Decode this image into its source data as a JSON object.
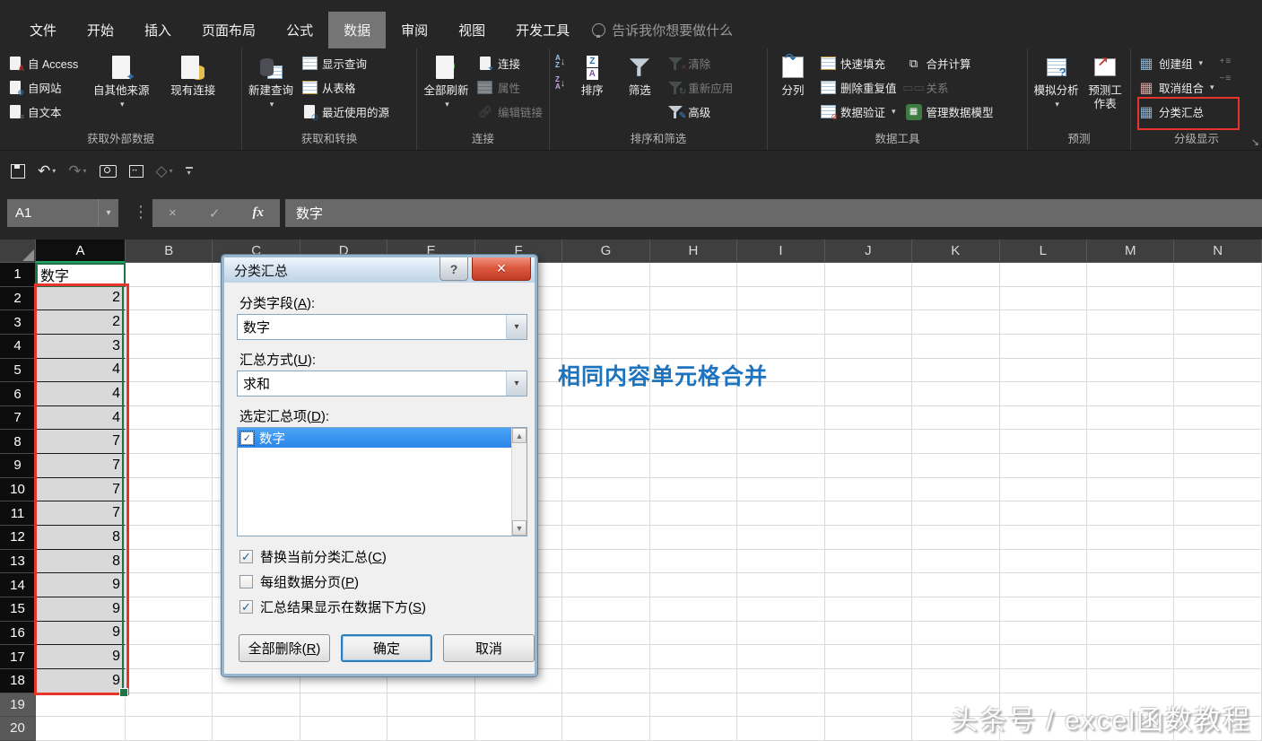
{
  "tabs": {
    "items": [
      "文件",
      "开始",
      "插入",
      "页面布局",
      "公式",
      "数据",
      "审阅",
      "视图",
      "开发工具"
    ],
    "selected_index": 5,
    "tell_me": "告诉我你想要做什么"
  },
  "ribbon": {
    "groups": [
      {
        "name": "获取外部数据",
        "items": [
          {
            "label": "自 Access"
          },
          {
            "label": "自网站"
          },
          {
            "label": "自文本"
          },
          {
            "label": "自其他来源"
          },
          {
            "label": "现有连接"
          }
        ]
      },
      {
        "name": "获取和转换",
        "items": [
          {
            "label": "新建查询"
          },
          {
            "label": "显示查询"
          },
          {
            "label": "从表格"
          },
          {
            "label": "最近使用的源"
          }
        ]
      },
      {
        "name": "连接",
        "items": [
          {
            "label": "全部刷新"
          },
          {
            "label": "连接"
          },
          {
            "label": "属性"
          },
          {
            "label": "编辑链接"
          }
        ]
      },
      {
        "name": "排序和筛选",
        "items": [
          {
            "label": "排序"
          },
          {
            "label": "筛选"
          },
          {
            "label": "清除"
          },
          {
            "label": "重新应用"
          },
          {
            "label": "高级"
          }
        ]
      },
      {
        "name": "数据工具",
        "items": [
          {
            "label": "分列"
          },
          {
            "label": "快速填充"
          },
          {
            "label": "删除重复值"
          },
          {
            "label": "数据验证"
          },
          {
            "label": "合并计算"
          },
          {
            "label": "关系"
          },
          {
            "label": "管理数据模型"
          }
        ]
      },
      {
        "name": "预测",
        "items": [
          {
            "label": "模拟分析"
          },
          {
            "label": "预测工作表"
          }
        ]
      },
      {
        "name": "分级显示",
        "items": [
          {
            "label": "创建组"
          },
          {
            "label": "取消组合"
          },
          {
            "label": "分类汇总"
          }
        ]
      }
    ]
  },
  "qat": {
    "icons": [
      "save-icon",
      "undo-icon",
      "redo-icon",
      "camera-icon",
      "window-icon",
      "shape-icon",
      "customize-qat-icon"
    ]
  },
  "formula_bar": {
    "name_box": "A1",
    "value": "数字"
  },
  "icons": {
    "dropdown": "▾",
    "cancel": "×",
    "enter": "✓",
    "fx": "fx",
    "help": "?",
    "close": "✕",
    "scroll_up": "▲",
    "scroll_down": "▼",
    "dots": "⋮",
    "undo": "↶",
    "redo": "↷",
    "refresh": "↻",
    "launcher": "↘",
    "advanced_pencil": "✎",
    "clear_x": "×",
    "reapply": "↻",
    "plus": "+",
    "minus": "−",
    "lines": "≡",
    "arrow_up_right": "↗",
    "question": "?"
  },
  "sheet": {
    "columns": [
      "A",
      "B",
      "C",
      "D",
      "E",
      "F",
      "G",
      "H",
      "I",
      "J",
      "K",
      "L",
      "M",
      "N"
    ],
    "rows_a": [
      "数字",
      "2",
      "2",
      "3",
      "4",
      "4",
      "4",
      "7",
      "7",
      "7",
      "7",
      "8",
      "8",
      "9",
      "9",
      "9",
      "9",
      "9",
      "",
      ""
    ],
    "row_numbers": [
      1,
      2,
      3,
      4,
      5,
      6,
      7,
      8,
      9,
      10,
      11,
      12,
      13,
      14,
      15,
      16,
      17,
      18,
      19,
      20
    ],
    "selected_rows_end": 18
  },
  "dialog": {
    "title": "分类汇总",
    "field_label": "分类字段(A):",
    "field_value": "数字",
    "method_label": "汇总方式(U):",
    "method_value": "求和",
    "items_label": "选定汇总项(D):",
    "items": [
      {
        "label": "数字",
        "checked": true
      }
    ],
    "checkboxes": [
      {
        "label": "替换当前分类汇总(C)",
        "checked": true
      },
      {
        "label": "每组数据分页(P)",
        "checked": false
      },
      {
        "label": "汇总结果显示在数据下方(S)",
        "checked": true
      }
    ],
    "buttons": {
      "delete_all": "全部删除(R)",
      "ok": "确定",
      "cancel": "取消"
    }
  },
  "annotation": {
    "text": "相同内容单元格合并",
    "color": "#1e73be"
  },
  "watermark": "头条号 / excel函数教程",
  "colors": {
    "accent_green": "#217346",
    "range_red": "#e8352c",
    "list_highlight": "#3094f5",
    "chrome": "#262626"
  }
}
